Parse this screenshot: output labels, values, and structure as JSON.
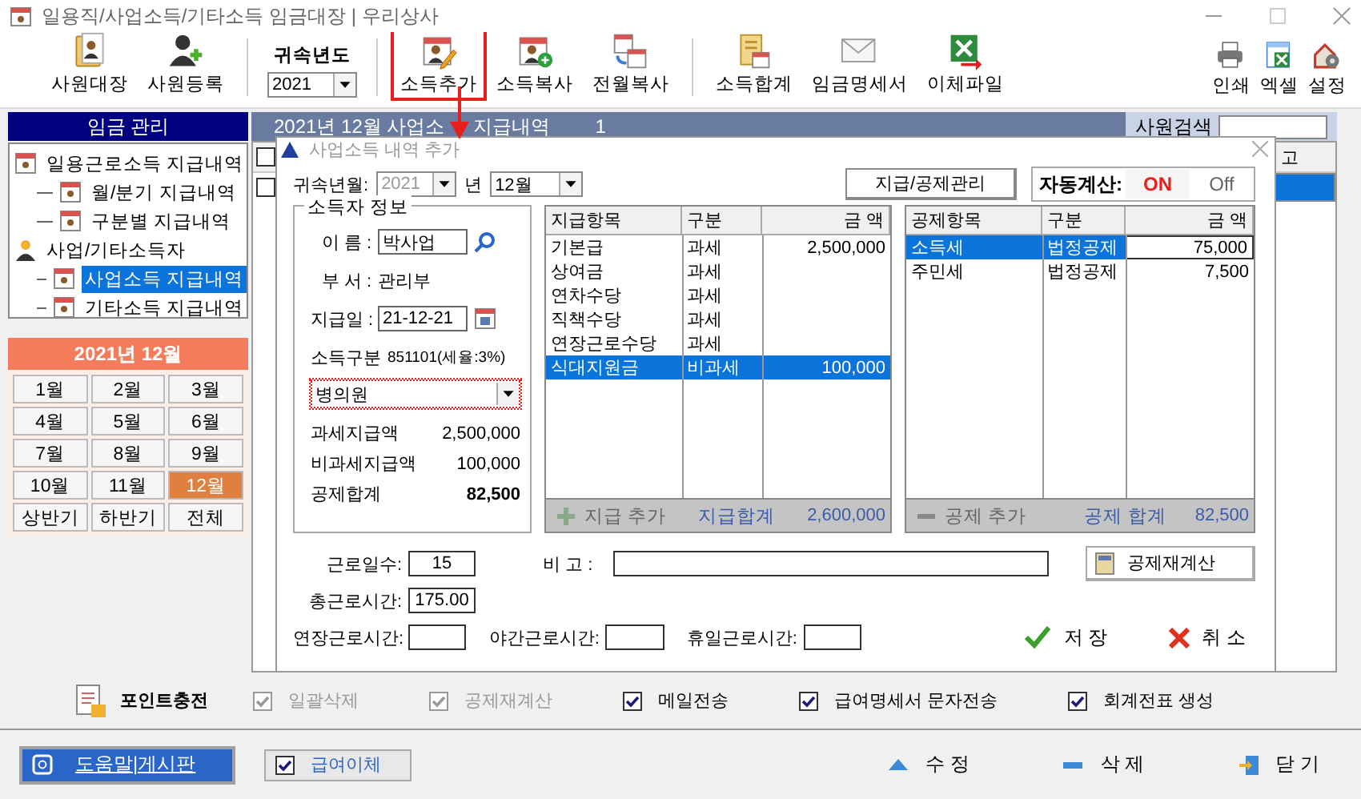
{
  "window": {
    "title": "일용직/사업소득/기타소득 임금대장  | 우리상사"
  },
  "toolbar": {
    "buttons_a": [
      {
        "label": "사원대장"
      },
      {
        "label": "사원등록"
      }
    ],
    "year": {
      "label": "귀속년도",
      "value": "2021"
    },
    "buttons_b": [
      {
        "label": "소득추가",
        "highlighted": true
      },
      {
        "label": "소득복사",
        "highlighted": false
      },
      {
        "label": "전월복사",
        "highlighted": false
      }
    ],
    "buttons_c": [
      {
        "label": "소득합계"
      },
      {
        "label": "임금명세서"
      },
      {
        "label": "이체파일"
      }
    ],
    "buttons_right": [
      {
        "label": "인쇄"
      },
      {
        "label": "엑셀"
      },
      {
        "label": "설정"
      }
    ]
  },
  "sidebar": {
    "title": "임금 관리",
    "tree": [
      {
        "label": "일용근로소득 지급내역",
        "selected": false,
        "children": [
          {
            "label": "월/분기 지급내역",
            "selected": false
          },
          {
            "label": "구분별 지급내역",
            "selected": false
          }
        ]
      },
      {
        "label": "사업/기타소득자",
        "selected": false,
        "children": [
          {
            "label": "사업소득 지급내역",
            "selected": true
          },
          {
            "label": "기타소득 지급내역",
            "selected": false
          }
        ]
      }
    ],
    "period_title": "2021년 12월",
    "periods": [
      {
        "label": "1월",
        "selected": false
      },
      {
        "label": "2월",
        "selected": false
      },
      {
        "label": "3월",
        "selected": false
      },
      {
        "label": "4월",
        "selected": false
      },
      {
        "label": "5월",
        "selected": false
      },
      {
        "label": "6월",
        "selected": false
      },
      {
        "label": "7월",
        "selected": false
      },
      {
        "label": "8월",
        "selected": false
      },
      {
        "label": "9월",
        "selected": false
      },
      {
        "label": "10월",
        "selected": false
      },
      {
        "label": "11월",
        "selected": false
      },
      {
        "label": "12월",
        "selected": true
      },
      {
        "label": "상반기",
        "selected": false
      },
      {
        "label": "하반기",
        "selected": false
      },
      {
        "label": "전체",
        "selected": false
      }
    ]
  },
  "list_panel": {
    "title_start": "2021년 12월 사업소",
    "title_end": "지급내역",
    "count": "1",
    "search_label": "사원검색",
    "header_checked": false,
    "column_tail": "고",
    "rows": [
      {
        "checked": false,
        "selected": true
      }
    ]
  },
  "dialog": {
    "title": "사업소득 내역 추가",
    "period": {
      "label": "귀속년월:",
      "year": "2021",
      "year_disabled": true,
      "year_suffix": "년",
      "month": "12월"
    },
    "manage_button": "지급/공제관리",
    "auto_calc": {
      "label": "자동계산:",
      "options": [
        {
          "label": "ON",
          "selected": true
        },
        {
          "label": "Off",
          "selected": false
        }
      ]
    },
    "earner": {
      "title": "소득자 정보",
      "name_label": "이 름 :",
      "name": "박사업",
      "dept_label": "부 서 :",
      "dept": "관리부",
      "date_label": "지급일 :",
      "date": "21-12-21",
      "type_label": "소득구분",
      "type_code": "851101(세율:3%)",
      "type_value": "병의원",
      "summary": [
        {
          "label": "과세지급액",
          "value": "2,500,000",
          "bold": false
        },
        {
          "label": "비과세지급액",
          "value": "100,000",
          "bold": false
        },
        {
          "label": "공제합계",
          "value": "82,500",
          "bold": true
        }
      ]
    },
    "payments": {
      "columns": [
        "지급항목",
        "구분",
        "금 액"
      ],
      "rows": [
        {
          "cells": [
            "기본급",
            "과세",
            "2,500,000"
          ],
          "selected": false
        },
        {
          "cells": [
            "상여금",
            "과세"
          ],
          "selected": false
        },
        {
          "cells": [
            "연차수당",
            "과세"
          ],
          "selected": false
        },
        {
          "cells": [
            "직책수당",
            "과세"
          ],
          "selected": false
        },
        {
          "cells": [
            "연장근로수당",
            "과세"
          ],
          "selected": false
        },
        {
          "cells": [
            "식대지원금",
            "비과세",
            "100,000"
          ],
          "selected": true
        }
      ],
      "add_label": "지급 추가",
      "total_label": "지급합계",
      "total": "2,600,000"
    },
    "deductions": {
      "columns": [
        "공제항목",
        "구분",
        "금 액"
      ],
      "rows": [
        {
          "cells": [
            "소득세",
            "법정공제",
            "75,000"
          ],
          "selected": true
        },
        {
          "cells": [
            "주민세",
            "법정공제",
            "7,500"
          ],
          "selected": false
        }
      ],
      "add_label": "공제 추가",
      "total_label": "공제 합계",
      "total": "82,500"
    },
    "work": {
      "days_label": "근로일수:",
      "days": "15",
      "note_label": "비 고 :",
      "total_hours_label": "총근로시간:",
      "total_hours": "175.00",
      "overtime_label": "연장근로시간:",
      "night_label": "야간근로시간:",
      "holiday_label": "휴일근로시간:"
    },
    "recalc_button": "공제재계산",
    "save_button": "저 장",
    "cancel_button": "취 소"
  },
  "options": {
    "point_button": "포인트충전",
    "checks": [
      {
        "label": "일괄삭제",
        "checked": true,
        "disabled": true
      },
      {
        "label": "공제재계산",
        "checked": true,
        "disabled": true
      },
      {
        "label": "메일전송",
        "checked": true,
        "disabled": false
      },
      {
        "label": "급여명세서 문자전송",
        "checked": true,
        "disabled": false
      },
      {
        "label": "회계전표 생성",
        "checked": true,
        "disabled": false
      }
    ]
  },
  "footer": {
    "help_button": "도움말|게시판",
    "transfer": {
      "label": "급여이체",
      "checked": true
    },
    "actions": [
      {
        "label": "수 정",
        "kind": "edit"
      },
      {
        "label": "삭 제",
        "kind": "delete"
      },
      {
        "label": "닫 기",
        "kind": "close"
      }
    ]
  }
}
